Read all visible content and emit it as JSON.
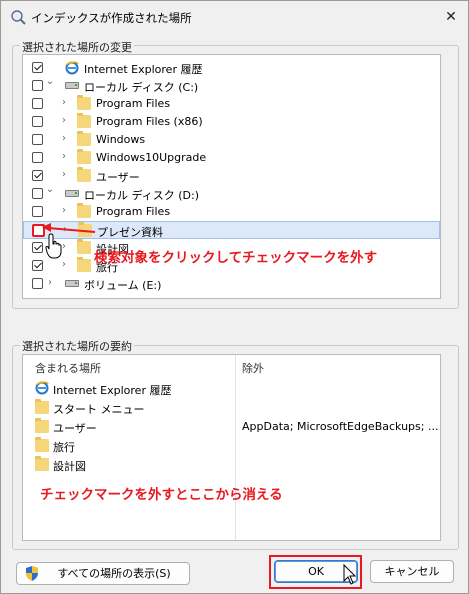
{
  "window": {
    "title": "インデックスが作成された場所"
  },
  "change_group": {
    "label": "選択された場所の変更"
  },
  "tree": {
    "rows": [
      {
        "label": "Internet Explorer 履歴",
        "checked": true,
        "indent": 0,
        "icon": "ie-icon"
      },
      {
        "label": "ローカル ディスク (C:)",
        "checked": false,
        "indent": 0,
        "icon": "drive-icon",
        "expanded": true
      },
      {
        "label": "Program Files",
        "checked": false,
        "indent": 1,
        "icon": "folder-icon"
      },
      {
        "label": "Program Files (x86)",
        "checked": false,
        "indent": 1,
        "icon": "folder-icon"
      },
      {
        "label": "Windows",
        "checked": false,
        "indent": 1,
        "icon": "folder-icon"
      },
      {
        "label": "Windows10Upgrade",
        "checked": false,
        "indent": 1,
        "icon": "folder-icon"
      },
      {
        "label": "ユーザー",
        "checked": true,
        "indent": 1,
        "icon": "folder-icon"
      },
      {
        "label": "ローカル ディスク (D:)",
        "checked": false,
        "indent": 0,
        "icon": "drive-icon",
        "expanded": true
      },
      {
        "label": "Program Files",
        "checked": false,
        "indent": 1,
        "icon": "folder-icon"
      },
      {
        "label": "プレゼン資料",
        "checked": false,
        "indent": 1,
        "icon": "folder-icon",
        "selected": true
      },
      {
        "label": "設計図",
        "checked": true,
        "indent": 1,
        "icon": "folder-icon"
      },
      {
        "label": "旅行",
        "checked": true,
        "indent": 1,
        "icon": "folder-icon"
      },
      {
        "label": "ボリューム (E:)",
        "checked": false,
        "indent": 0,
        "icon": "drive-icon"
      }
    ]
  },
  "annotations": {
    "top": "検索対象をクリックしてチェックマークを外す",
    "bottom": "チェックマークを外すとここから消える",
    "color": "#e8191f"
  },
  "summary_group": {
    "label": "選択された場所の要約",
    "col_included": "含まれる場所",
    "col_excluded": "除外",
    "items": [
      {
        "label": "Internet Explorer 履歴",
        "icon": "ie-icon"
      },
      {
        "label": "スタート メニュー",
        "icon": "folder-icon"
      },
      {
        "label": "ユーザー",
        "icon": "folder-icon"
      },
      {
        "label": "旅行",
        "icon": "folder-icon"
      },
      {
        "label": "設計図",
        "icon": "folder-icon"
      }
    ],
    "excluded_text": "AppData; MicrosoftEdgeBackups; ..."
  },
  "buttons": {
    "show_all": "すべての場所の表示(S)",
    "ok": "OK",
    "cancel": "キャンセル"
  },
  "colors": {
    "accent": "#3c78c8",
    "selection": "#dde9f8"
  }
}
